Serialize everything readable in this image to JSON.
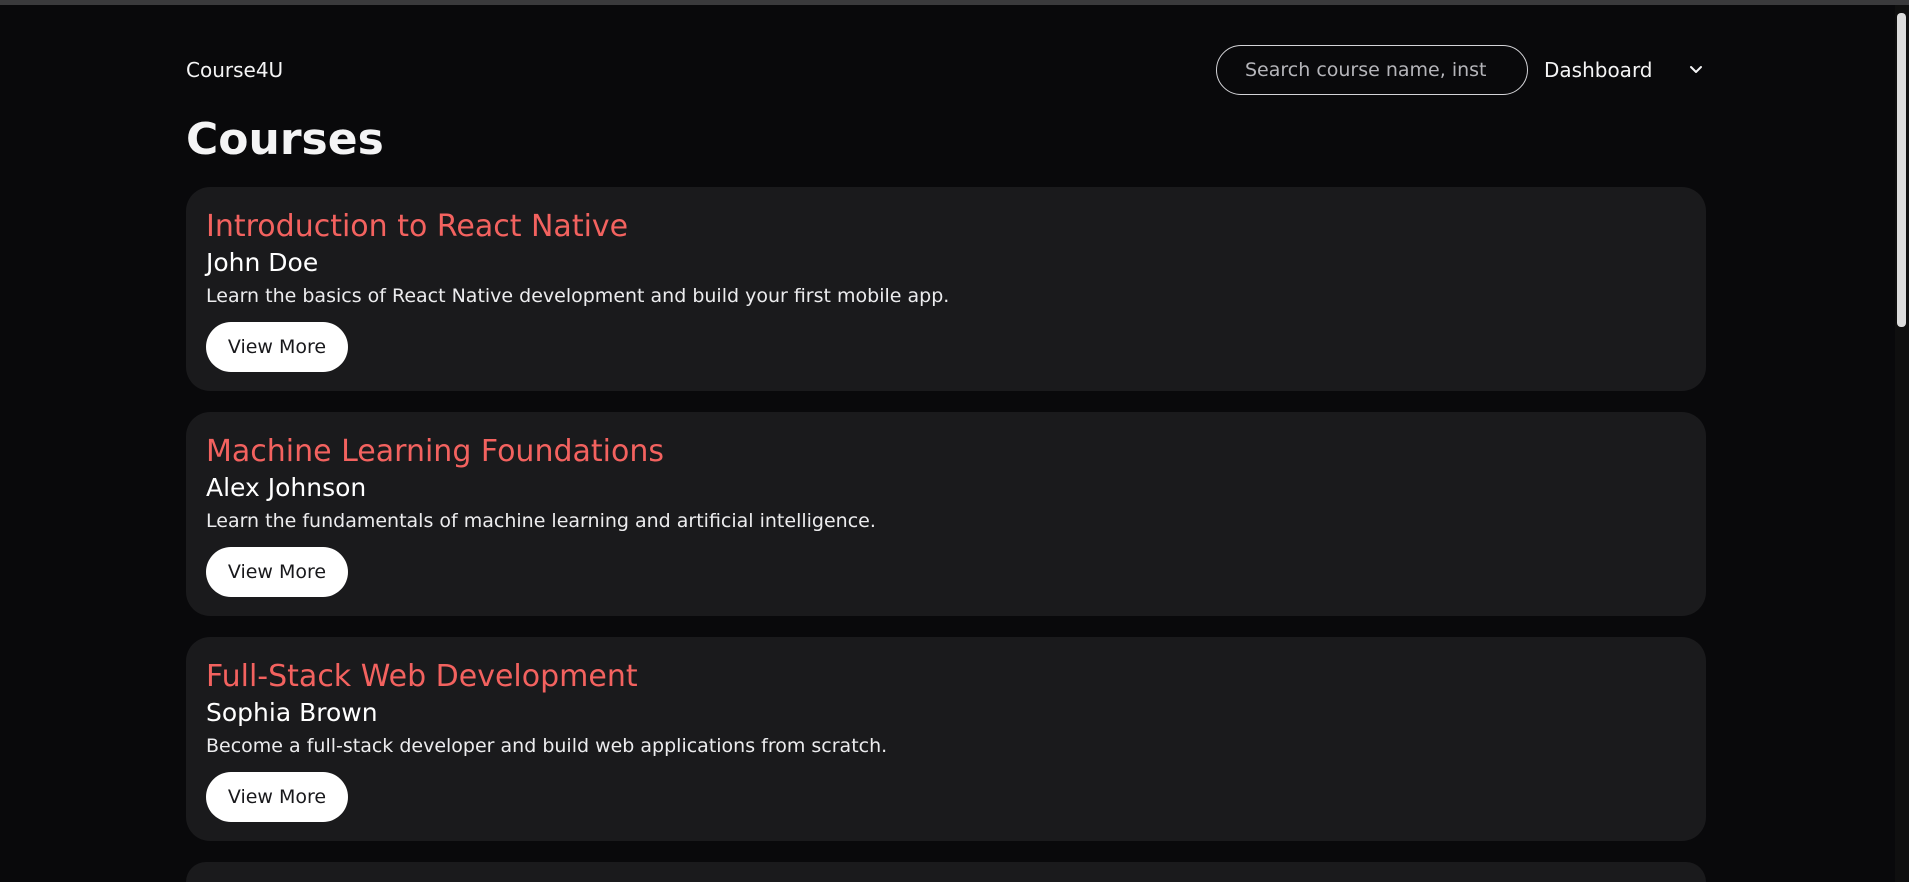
{
  "header": {
    "brand": "Course4U",
    "search_placeholder": "Search course name, inst",
    "dashboard_label": "Dashboard"
  },
  "main": {
    "title": "Courses",
    "courses": [
      {
        "title": "Introduction to React Native",
        "instructor": "John Doe",
        "description": "Learn the basics of React Native development and build your first mobile app.",
        "button": "View More"
      },
      {
        "title": "Machine Learning Foundations",
        "instructor": "Alex Johnson",
        "description": "Learn the fundamentals of machine learning and artificial intelligence.",
        "button": "View More"
      },
      {
        "title": "Full-Stack Web Development",
        "instructor": "Sophia Brown",
        "description": "Become a full-stack developer and build web applications from scratch.",
        "button": "View More"
      }
    ]
  },
  "colors": {
    "background": "#09090b",
    "card": "#1a1a1c",
    "accent": "#f3625f"
  }
}
